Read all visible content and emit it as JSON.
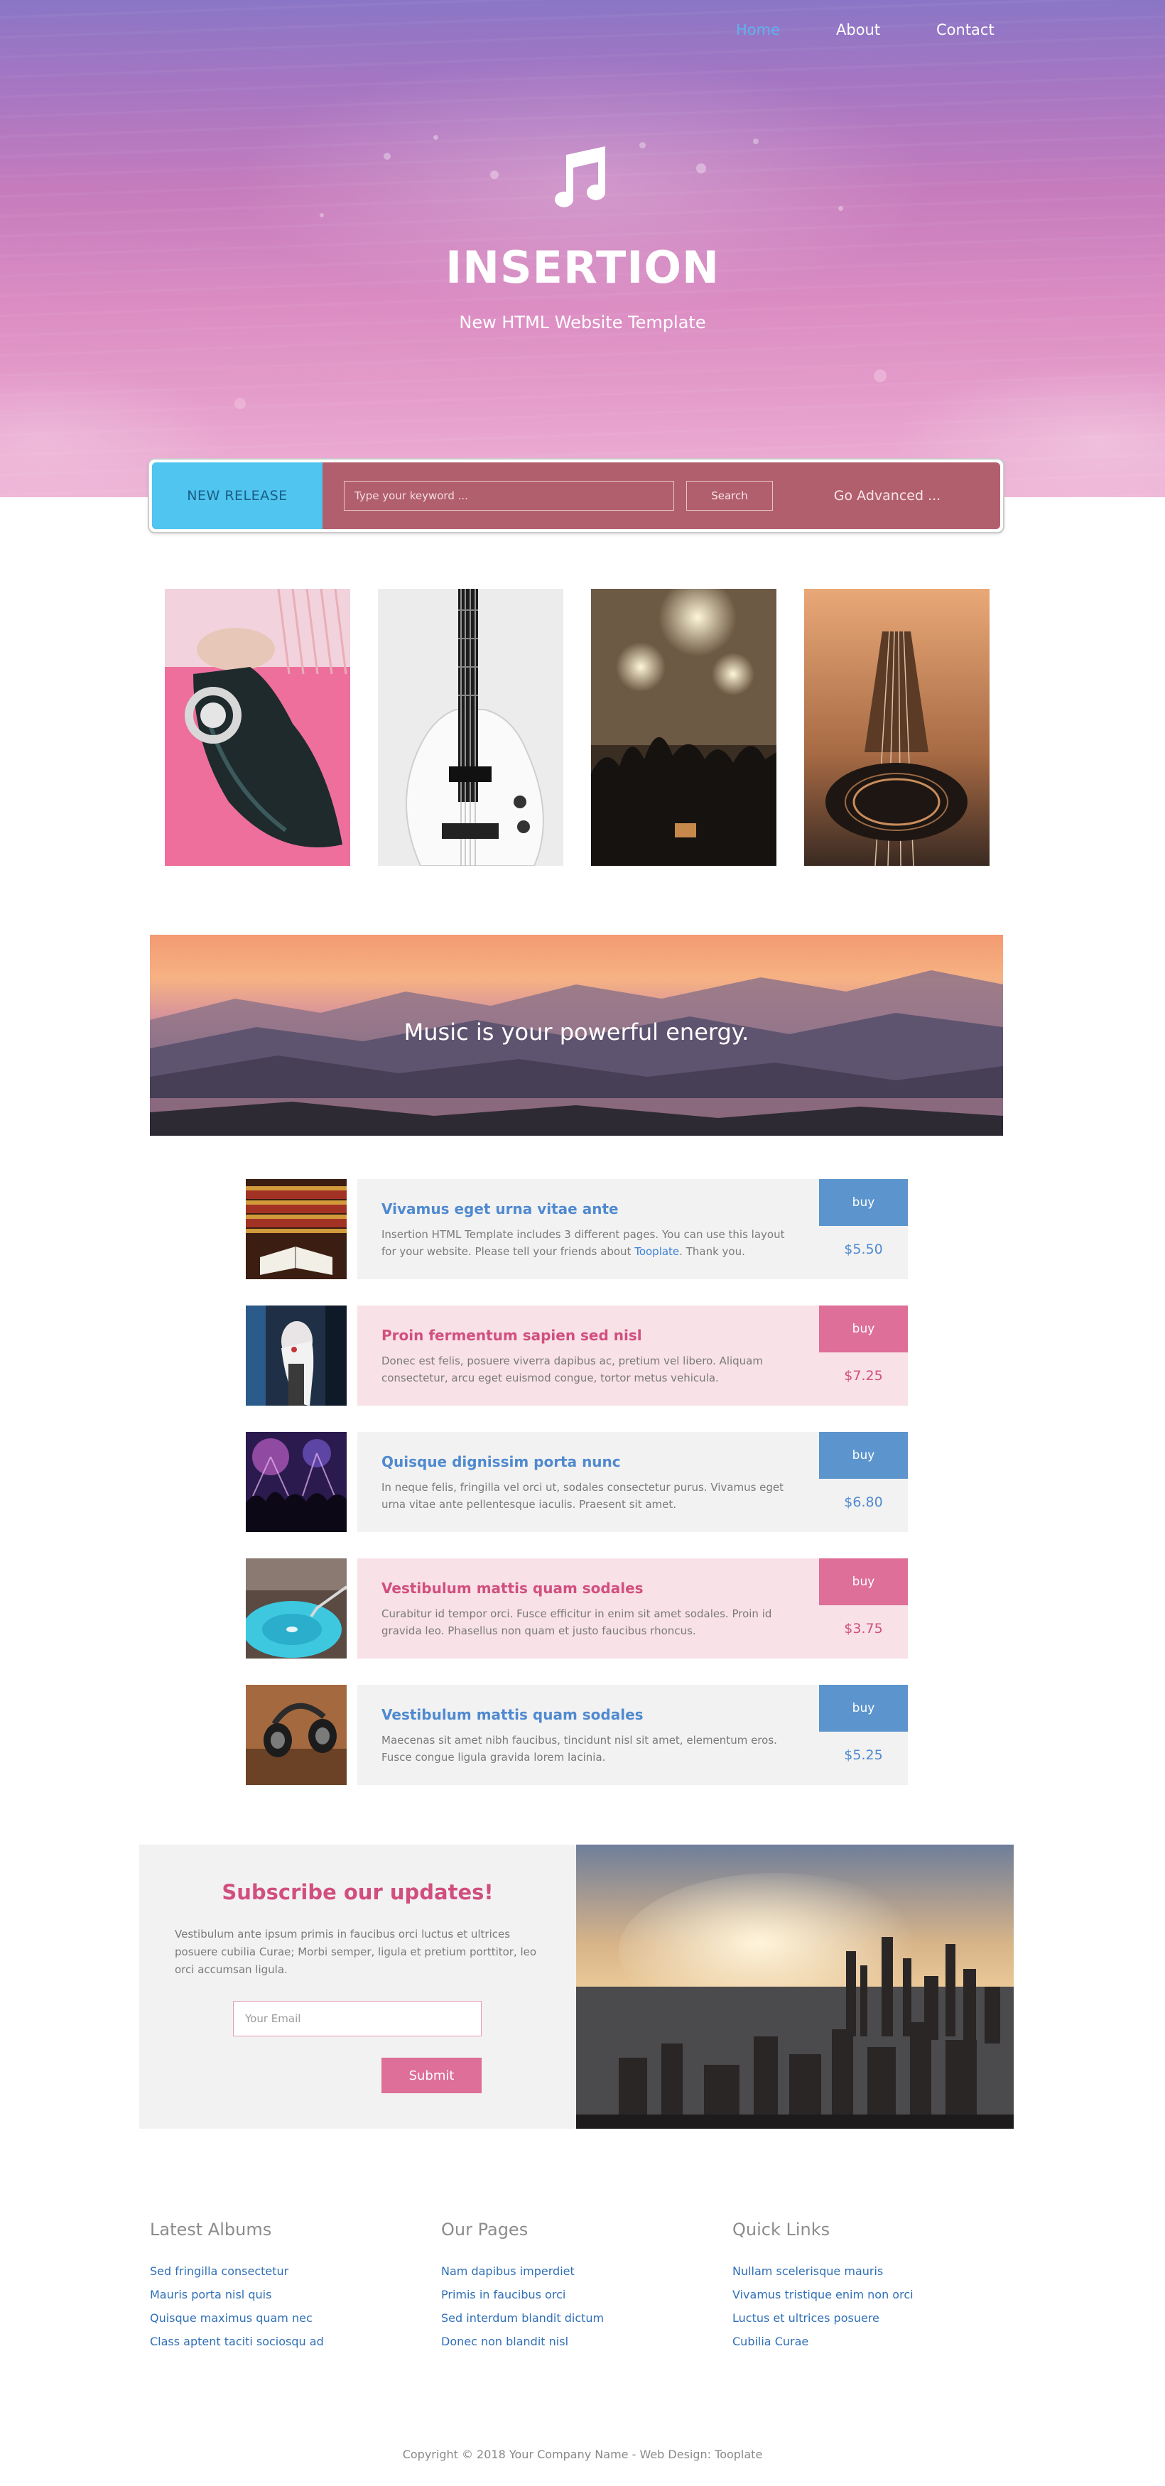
{
  "nav": {
    "items": [
      {
        "label": "Home",
        "active": true
      },
      {
        "label": "About",
        "active": false
      },
      {
        "label": "Contact",
        "active": false
      }
    ]
  },
  "hero": {
    "icon": "music-note-icon",
    "title": "INSERTION",
    "subtitle": "New HTML Website Template"
  },
  "searchbar": {
    "new_release": "NEW RELEASE",
    "placeholder": "Type your keyword ...",
    "search_label": "Search",
    "advanced_label": "Go Advanced ..."
  },
  "gallery": [
    {
      "subject": "woman-headphones-photo"
    },
    {
      "subject": "bass-guitar-photo"
    },
    {
      "subject": "concert-crowd-photo"
    },
    {
      "subject": "acoustic-guitar-photo"
    }
  ],
  "banner": {
    "text": "Music is your powerful energy."
  },
  "products": [
    {
      "theme": "blue",
      "title": "Vivamus eget urna vitae ante",
      "desc_before_link": "Insertion HTML Template includes 3 different pages. You can use this layout for your website. Please tell your friends about ",
      "link": "Tooplate",
      "desc_after_link": ". Thank you.",
      "buy": "buy",
      "price": "$5.50",
      "image": "opera-hall-photo"
    },
    {
      "theme": "pink",
      "title": "Proin fermentum sapien sed nisl",
      "desc_before_link": "Donec est felis, posuere viverra dapibus ac, pretium vel libero. Aliquam consectetur, arcu eget euismod congue, tortor metus vehicula.",
      "link": "",
      "desc_after_link": "",
      "buy": "buy",
      "price": "$7.25",
      "image": "singer-photo"
    },
    {
      "theme": "blue",
      "title": "Quisque dignissim porta nunc",
      "desc_before_link": "In neque felis, fringilla vel orci ut, sodales consectetur purus. Vivamus eget urna vitae ante pellentesque iaculis. Praesent sit amet.",
      "link": "",
      "desc_after_link": "",
      "buy": "buy",
      "price": "$6.80",
      "image": "concert-lights-photo"
    },
    {
      "theme": "pink",
      "title": "Vestibulum mattis quam sodales",
      "desc_before_link": "Curabitur id tempor orci. Fusce efficitur in enim sit amet sodales. Proin id gravida leo. Phasellus non quam et justo faucibus rhoncus.",
      "link": "",
      "desc_after_link": "",
      "buy": "buy",
      "price": "$3.75",
      "image": "turntable-photo"
    },
    {
      "theme": "blue",
      "title": "Vestibulum mattis quam sodales",
      "desc_before_link": "Maecenas sit amet nibh faucibus, tincidunt nisl sit amet, elementum eros. Fusce congue ligula gravida lorem lacinia.",
      "link": "",
      "desc_after_link": "",
      "buy": "buy",
      "price": "$5.25",
      "image": "headphones-photo"
    }
  ],
  "subscribe": {
    "title": "Subscribe our updates!",
    "desc": "Vestibulum ante ipsum primis in faucibus orci luctus et ultrices posuere cubilia Curae; Morbi semper, ligula et pretium porttitor, leo orci accumsan ligula.",
    "email_placeholder": "Your Email",
    "submit": "Submit",
    "image": "city-skyline-photo"
  },
  "footer": {
    "columns": [
      {
        "title": "Latest Albums",
        "links": [
          "Sed fringilla consectetur",
          "Mauris porta nisl quis",
          "Quisque maximus quam nec",
          "Class aptent taciti sociosqu ad"
        ]
      },
      {
        "title": "Our Pages",
        "links": [
          "Nam dapibus imperdiet",
          "Primis in faucibus orci",
          "Sed interdum blandit dictum",
          "Donec non blandit nisl"
        ]
      },
      {
        "title": "Quick Links",
        "links": [
          "Nullam scelerisque mauris",
          "Vivamus tristique enim non orci",
          "Luctus et ultrices posuere",
          "Cubilia Curae"
        ]
      }
    ],
    "copyright": "Copyright © 2018 Your Company Name - Web Design: Tooplate"
  },
  "colors": {
    "accent_blue": "#5c95cd",
    "accent_pink": "#dd6f98",
    "new_release_bg": "#4fc5f0",
    "search_bg": "#b25f6d"
  }
}
